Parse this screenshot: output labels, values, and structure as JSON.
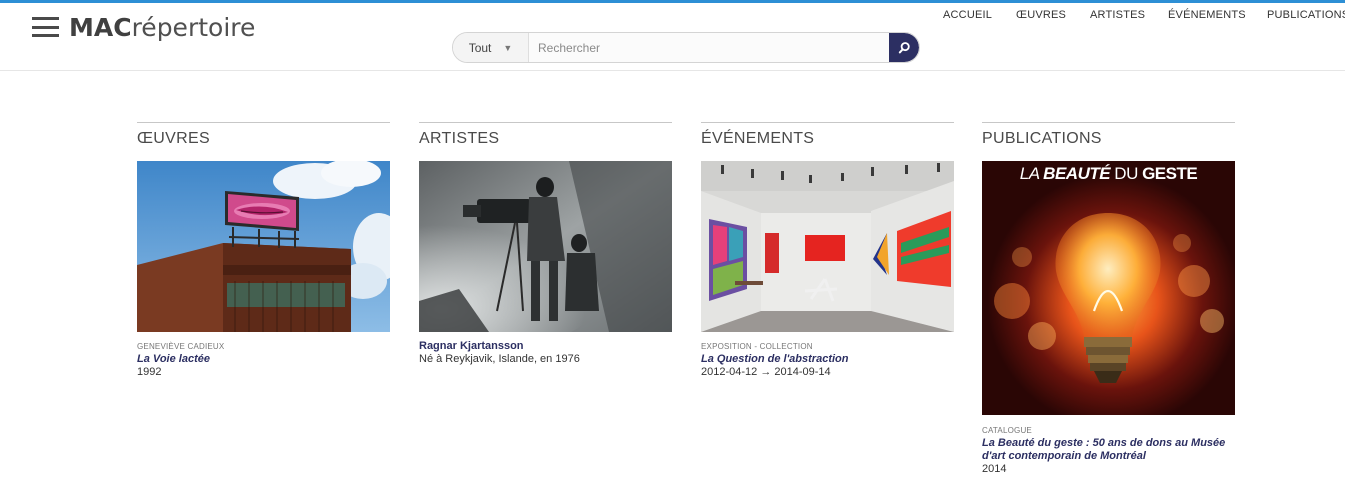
{
  "brand": {
    "bold": "MAC",
    "light": "répertoire"
  },
  "search": {
    "scope": "Tout",
    "placeholder": "Rechercher"
  },
  "nav": [
    {
      "label": "ACCUEIL"
    },
    {
      "label": "ŒUVRES"
    },
    {
      "label": "ARTISTES"
    },
    {
      "label": "ÉVÉNEMENTS"
    },
    {
      "label": "PUBLICATIONS"
    }
  ],
  "columns": {
    "oeuvres": {
      "heading": "ŒUVRES",
      "kicker": "GENEVIÈVE CADIEUX",
      "title": "La Voie lactée",
      "detail": "1992"
    },
    "artistes": {
      "heading": "ARTISTES",
      "name": "Ragnar Kjartansson",
      "detail": "Né à Reykjavik, Islande, en 1976"
    },
    "evenements": {
      "heading": "ÉVÉNEMENTS",
      "kicker": "EXPOSITION - COLLECTION",
      "title": "La Question de l'abstraction",
      "detail": "2012-04-12 → 2014-09-14"
    },
    "publications": {
      "heading": "PUBLICATIONS",
      "cover_title_a": "LA ",
      "cover_title_b": "BEAUTÉ",
      "cover_title_c": " DU ",
      "cover_title_d": "GESTE",
      "kicker": "CATALOGUE",
      "title": "La Beauté du geste : 50 ans de dons au Musée d'art contemporain de Montréal",
      "detail": "2014"
    }
  },
  "colors": {
    "accent": "#2c2f62",
    "topline": "#2d8fd5"
  }
}
